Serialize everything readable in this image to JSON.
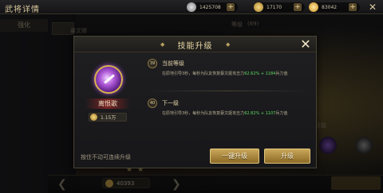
{
  "background": {
    "page_title": "武将详情",
    "resources": [
      {
        "icon": "silver-coin-icon",
        "value": "1425708"
      },
      {
        "icon": "gold-coin-icon",
        "value": "17170"
      },
      {
        "icon": "gem-icon",
        "value": "83042"
      }
    ],
    "tab_label": "强化",
    "side_label": "暴文姬",
    "level_label": "等级",
    "level_value": "(69)",
    "bottom_coin_value": "40393",
    "right_label_a": "技能",
    "right_label_b": "技能升级"
  },
  "modal": {
    "title": "技能升级",
    "skill": {
      "name": "离恨歌",
      "cost": "1.15万"
    },
    "current": {
      "badge": "39",
      "title": "当前等级",
      "desc_pre": "在原地引导3秒，每秒为队友恢复蔡文姬攻击力",
      "desc_hl": "62.62% + 1184",
      "desc_post": "兵力值"
    },
    "next": {
      "badge": "40",
      "title": "下一级",
      "desc_pre": "在原地引导3秒，每秒为队友恢复蔡文姬攻击力",
      "desc_hl": "62.82% + 1107",
      "desc_post": "兵力值"
    },
    "footer_note": "按住不动可连续升级",
    "btn_onekey": "一键升级",
    "btn_upgrade": "升级"
  }
}
